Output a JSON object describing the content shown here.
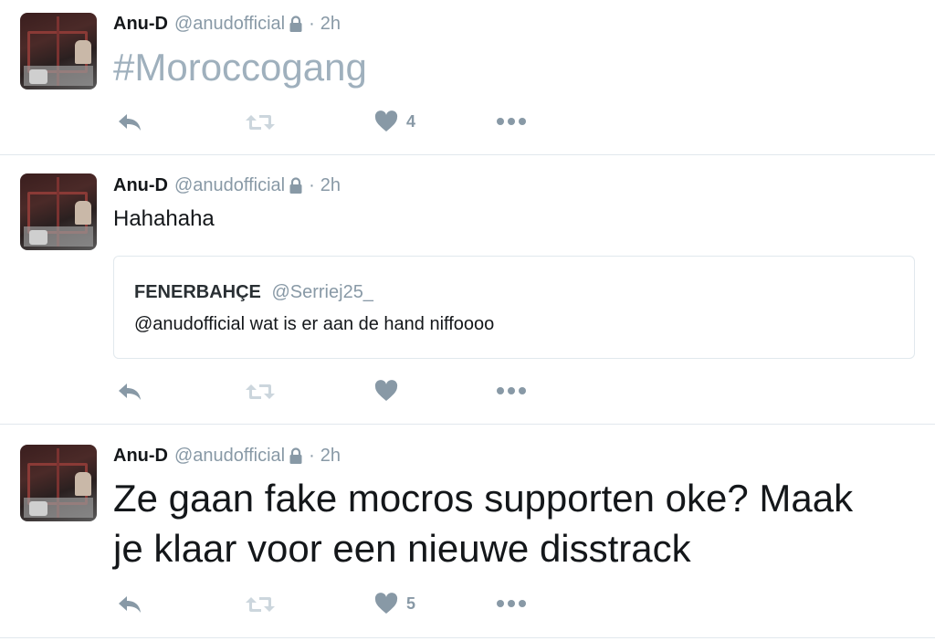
{
  "tweets": [
    {
      "name": "Anu-D",
      "handle": "@anudofficial",
      "dot": "·",
      "time": "2h",
      "text": "#Moroccogang",
      "like_count": "4"
    },
    {
      "name": "Anu-D",
      "handle": "@anudofficial",
      "dot": "·",
      "time": "2h",
      "text": "Hahahaha",
      "quote": {
        "name": "FENERBAHÇE",
        "handle": "@Serriej25_",
        "text": "@anudofficial wat is er aan de hand niffoooo"
      },
      "like_count": ""
    },
    {
      "name": "Anu-D",
      "handle": "@anudofficial",
      "dot": "·",
      "time": "2h",
      "text_line1": "Ze gaan fake mocros supporten oke? Maak",
      "text_line2": "je klaar voor een nieuwe disstrack",
      "like_count": "5"
    }
  ],
  "icons": {
    "reply": "reply-icon",
    "retweet": "retweet-icon",
    "like": "heart-icon",
    "more": "more-icon",
    "lock": "lock-icon"
  },
  "colors": {
    "icon_gray": "#8899a6",
    "icon_light": "#ccd6dd",
    "divider": "#e1e8ed"
  }
}
